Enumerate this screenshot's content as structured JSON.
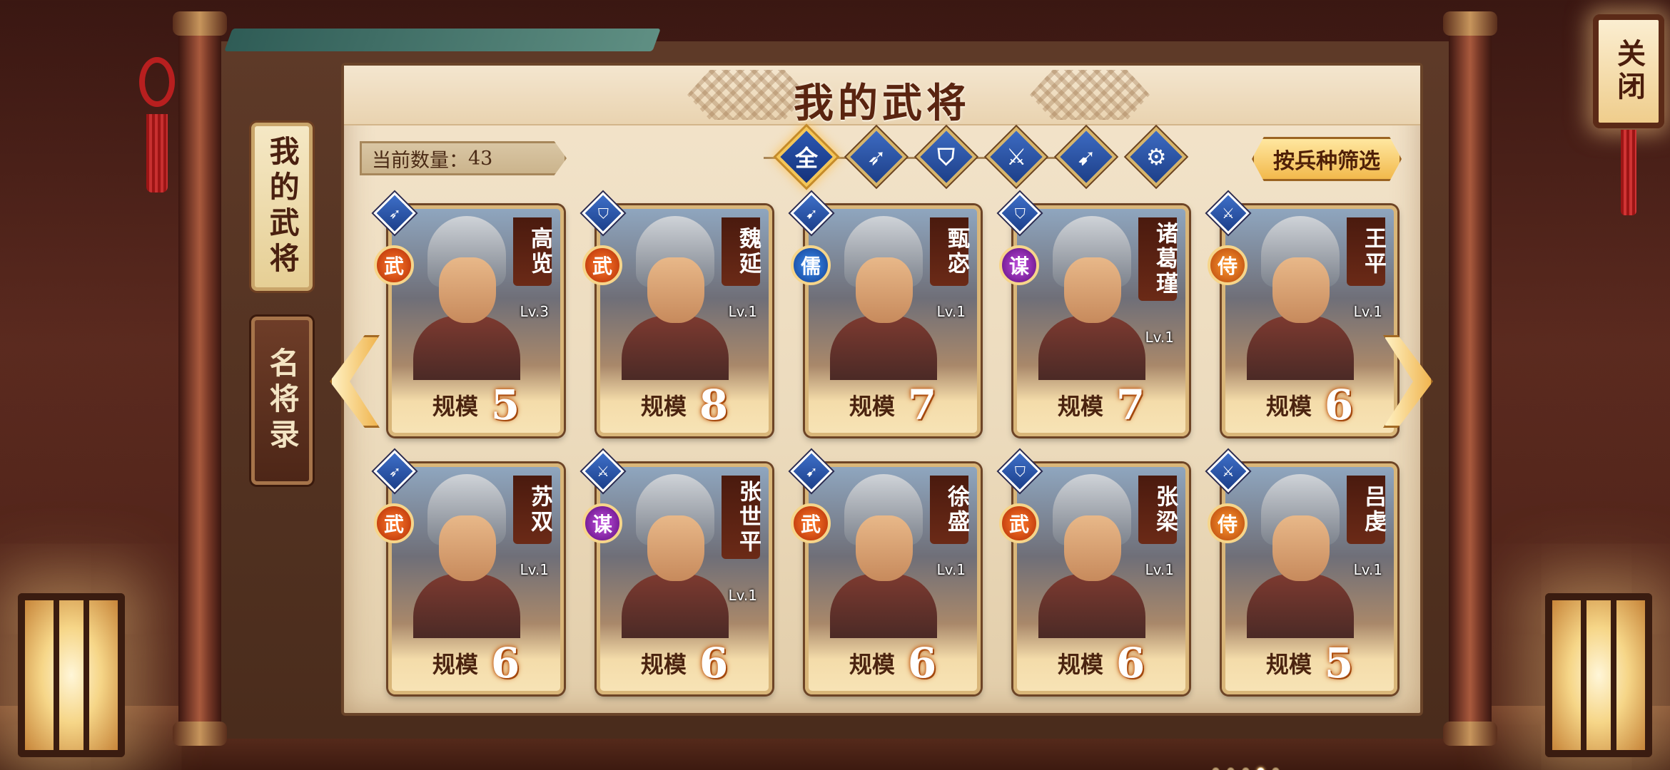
{
  "title": "我的武将",
  "tabs": [
    {
      "label": "我的武将",
      "active": true
    },
    {
      "label": "名将录",
      "active": false
    }
  ],
  "count": {
    "label": "当前数量：",
    "value": "43"
  },
  "filters": [
    {
      "icon": "全",
      "name": "all",
      "selected": true
    },
    {
      "icon": "➶",
      "name": "cavalry",
      "selected": false
    },
    {
      "icon": "⛉",
      "name": "shield",
      "selected": false
    },
    {
      "icon": "⚔",
      "name": "spear",
      "selected": false
    },
    {
      "icon": "➹",
      "name": "bow",
      "selected": false
    },
    {
      "icon": "⚙",
      "name": "siege",
      "selected": false
    }
  ],
  "filter_sort_label": "按兵种筛选",
  "close_label": "关闭",
  "scale_label": "规模",
  "generals": [
    {
      "name": "高览",
      "level": "Lv.3",
      "class": "武",
      "unit_icon": "➶",
      "scale": "5"
    },
    {
      "name": "魏延",
      "level": "Lv.1",
      "class": "武",
      "unit_icon": "⛉",
      "scale": "8"
    },
    {
      "name": "甄宓",
      "level": "Lv.1",
      "class": "儒",
      "unit_icon": "➹",
      "scale": "7"
    },
    {
      "name": "诸葛瑾",
      "level": "Lv.1",
      "class": "谋",
      "unit_icon": "⛉",
      "scale": "7"
    },
    {
      "name": "王平",
      "level": "Lv.1",
      "class": "侍",
      "unit_icon": "⚔",
      "scale": "6"
    },
    {
      "name": "苏双",
      "level": "Lv.1",
      "class": "武",
      "unit_icon": "➶",
      "scale": "6"
    },
    {
      "name": "张世平",
      "level": "Lv.1",
      "class": "谋",
      "unit_icon": "⚔",
      "scale": "6"
    },
    {
      "name": "徐盛",
      "level": "Lv.1",
      "class": "武",
      "unit_icon": "➹",
      "scale": "6"
    },
    {
      "name": "张梁",
      "level": "Lv.1",
      "class": "武",
      "unit_icon": "⛉",
      "scale": "6"
    },
    {
      "name": "吕虔",
      "level": "Lv.1",
      "class": "侍",
      "unit_icon": "⚔",
      "scale": "5"
    }
  ],
  "pager": {
    "pages": 5,
    "current": 4
  }
}
